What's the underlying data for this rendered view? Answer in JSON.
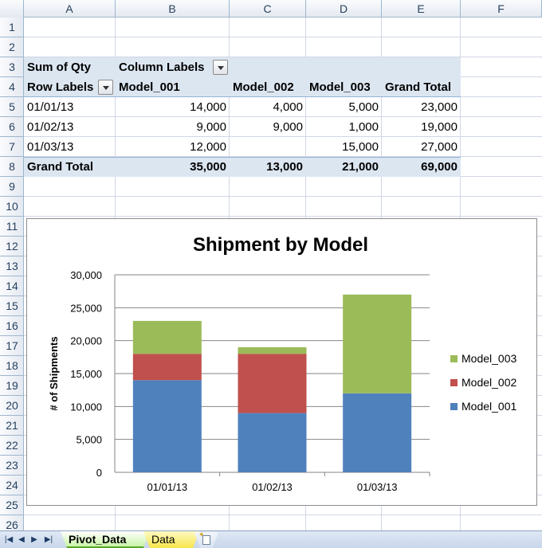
{
  "columns": [
    "A",
    "B",
    "C",
    "D",
    "E",
    "F"
  ],
  "rows": [
    "1",
    "2",
    "3",
    "4",
    "5",
    "6",
    "7",
    "8",
    "9",
    "10",
    "11",
    "12",
    "13",
    "14",
    "15",
    "16",
    "17",
    "18",
    "19",
    "20",
    "21",
    "22",
    "23",
    "24",
    "25",
    "26"
  ],
  "pivot": {
    "values_label": "Sum of Qty",
    "column_labels": "Column Labels",
    "row_labels": "Row Labels",
    "headers": [
      "Model_001",
      "Model_002",
      "Model_003",
      "Grand Total"
    ],
    "rows": [
      {
        "label": "01/01/13",
        "m1": "14,000",
        "m2": "4,000",
        "m3": "5,000",
        "total": "23,000"
      },
      {
        "label": "01/02/13",
        "m1": "9,000",
        "m2": "9,000",
        "m3": "1,000",
        "total": "19,000"
      },
      {
        "label": "01/03/13",
        "m1": "12,000",
        "m2": "",
        "m3": "15,000",
        "total": "27,000"
      }
    ],
    "grand_total": {
      "label": "Grand Total",
      "m1": "35,000",
      "m2": "13,000",
      "m3": "21,000",
      "total": "69,000"
    }
  },
  "chart_data": {
    "type": "bar",
    "stacked": true,
    "title": "Shipment by Model",
    "ylabel": "# of Shipments",
    "xlabel": "",
    "categories": [
      "01/01/13",
      "01/02/13",
      "01/03/13"
    ],
    "series": [
      {
        "name": "Model_001",
        "values": [
          14000,
          9000,
          12000
        ],
        "color": "#4f81bd"
      },
      {
        "name": "Model_002",
        "values": [
          4000,
          9000,
          0
        ],
        "color": "#c0504d"
      },
      {
        "name": "Model_003",
        "values": [
          5000,
          1000,
          15000
        ],
        "color": "#9bbb59"
      }
    ],
    "ylim": [
      0,
      30000
    ],
    "yticks": [
      0,
      5000,
      10000,
      15000,
      20000,
      25000,
      30000
    ],
    "ytick_labels": [
      "0",
      "5,000",
      "10,000",
      "15,000",
      "20,000",
      "25,000",
      "30,000"
    ],
    "grid": true,
    "legend": "right"
  },
  "tabs": {
    "sheets": [
      "Pivot_Data",
      "Data"
    ],
    "active": "Pivot_Data",
    "nav": {
      "first": "|◀",
      "prev": "◀",
      "next": "▶",
      "last": "▶|"
    },
    "new_sheet_icon": "insert-sheet-icon"
  }
}
